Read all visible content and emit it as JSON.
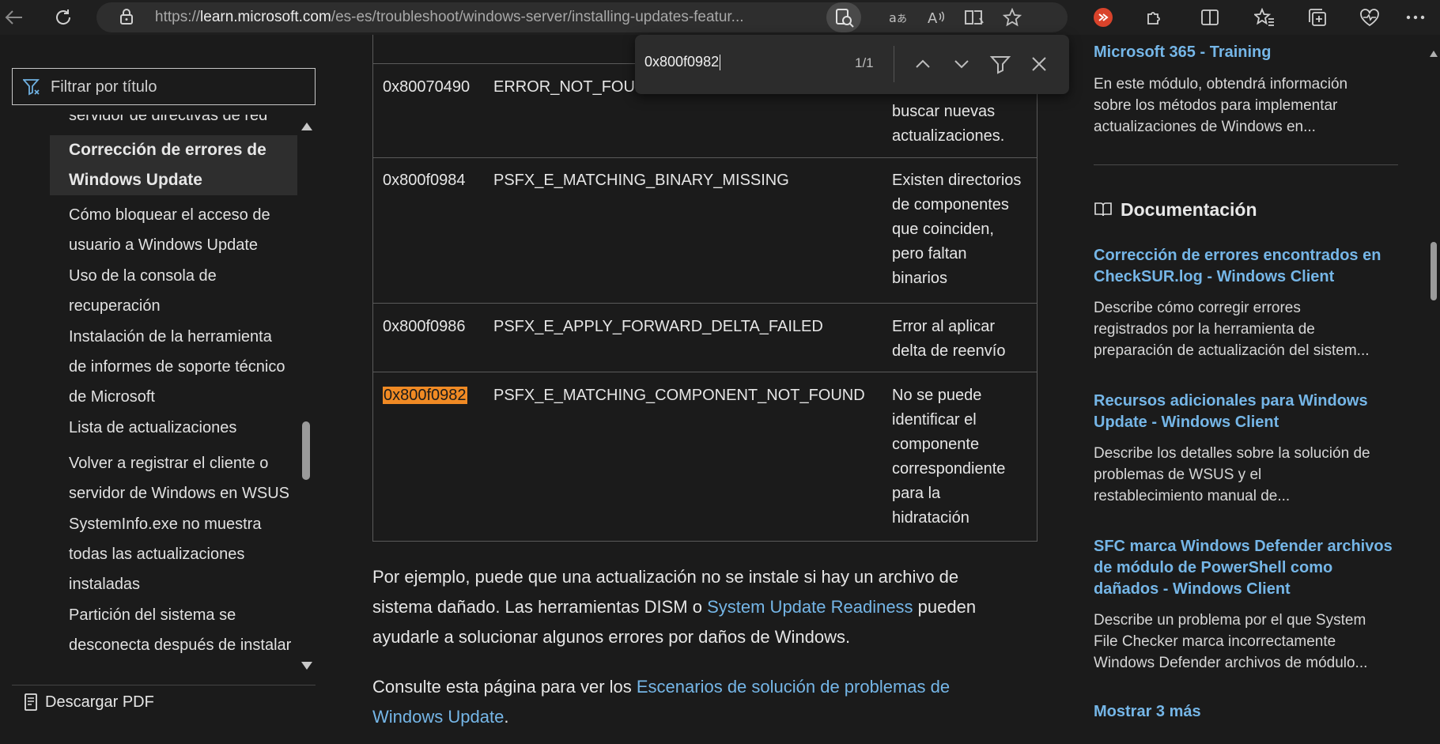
{
  "browser": {
    "url_prefix": "https://",
    "url_host": "learn.microsoft.com",
    "url_path": "/es-es/troubleshoot/windows-server/installing-updates-featur..."
  },
  "find": {
    "query": "0x800f0982",
    "count": "1/1"
  },
  "sidebar": {
    "filter_placeholder": "Filtrar por título",
    "partial_item": "servidor de directivas de red",
    "active_item_line1": "Corrección de errores de",
    "active_item_line2": "Windows Update",
    "items": [
      {
        "l1": "Cómo bloquear el acceso de",
        "l2": "usuario a Windows Update"
      },
      {
        "l1": "Uso de la consola de",
        "l2": "recuperación"
      },
      {
        "l1": "Instalación de la herramienta",
        "l2": "de informes de soporte técnico",
        "l3": "de Microsoft"
      },
      {
        "l1": "Lista de actualizaciones"
      },
      {
        "l1": "Volver a registrar el cliente o",
        "l2": "servidor de Windows en WSUS"
      },
      {
        "l1": "SystemInfo.exe no muestra",
        "l2": "todas las actualizaciones",
        "l3": "instaladas"
      },
      {
        "l1": "Partición del sistema se",
        "l2": "desconecta después de instalar"
      }
    ],
    "download_pdf": "Descargar PDF"
  },
  "table": {
    "rows": [
      {
        "code": "0x80070490",
        "name": "ERROR_NOT_FOUND",
        "desc": [
          "buscar nuevas",
          "actualizaciones."
        ]
      },
      {
        "code": "0x800f0984",
        "name": "PSFX_E_MATCHING_BINARY_MISSING",
        "desc": [
          "Existen directorios",
          "de componentes",
          "que coinciden,",
          "pero faltan",
          "binarios"
        ]
      },
      {
        "code": "0x800f0986",
        "name": "PSFX_E_APPLY_FORWARD_DELTA_FAILED",
        "desc": [
          "Error al aplicar",
          "delta de reenvío"
        ]
      },
      {
        "code": "0x800f0982",
        "name": "PSFX_E_MATCHING_COMPONENT_NOT_FOUND",
        "desc": [
          "No se puede",
          "identificar el",
          "componente",
          "correspondiente",
          "para la",
          "hidratación"
        ]
      }
    ]
  },
  "body": {
    "p1_a": "Por ejemplo, puede que una actualización no se instale si hay un archivo de",
    "p1_b": "sistema dañado. Las herramientas DISM o ",
    "p1_link": "System Update Readiness",
    "p1_c": " pueden",
    "p1_d": "ayudarle a solucionar algunos errores por daños de Windows.",
    "p2_a": "Consulte esta página para ver los ",
    "p2_link1": "Escenarios de solución de problemas de",
    "p2_link2": "Windows Update",
    "p2_end": "."
  },
  "right": {
    "training_title": "Microsoft 365 - Training",
    "training_desc": [
      "En este módulo, obtendrá información",
      "sobre los métodos para implementar",
      "actualizaciones de Windows en..."
    ],
    "doc_heading": "Documentación",
    "docs": [
      {
        "t": [
          "Corrección de errores encontrados en",
          "CheckSUR.log - Windows Client"
        ],
        "d": [
          "Describe cómo corregir errores",
          "registrados por la herramienta de",
          "preparación de actualización del sistem..."
        ]
      },
      {
        "t": [
          "Recursos adicionales para Windows",
          "Update - Windows Client"
        ],
        "d": [
          "Describe los detalles sobre la solución de",
          "problemas de WSUS y el",
          "restablecimiento manual de..."
        ]
      },
      {
        "t": [
          "SFC marca Windows Defender archivos",
          "de módulo de PowerShell como",
          "dañados - Windows Client"
        ],
        "d": [
          "Describe un problema por el que System",
          "File Checker marca incorrectamente",
          "Windows Defender archivos de módulo..."
        ]
      }
    ],
    "show_more": "Mostrar 3 más"
  },
  "colors": {
    "link": "#75b6e7",
    "highlight": "#f08a24",
    "background": "#1b1b1b"
  }
}
